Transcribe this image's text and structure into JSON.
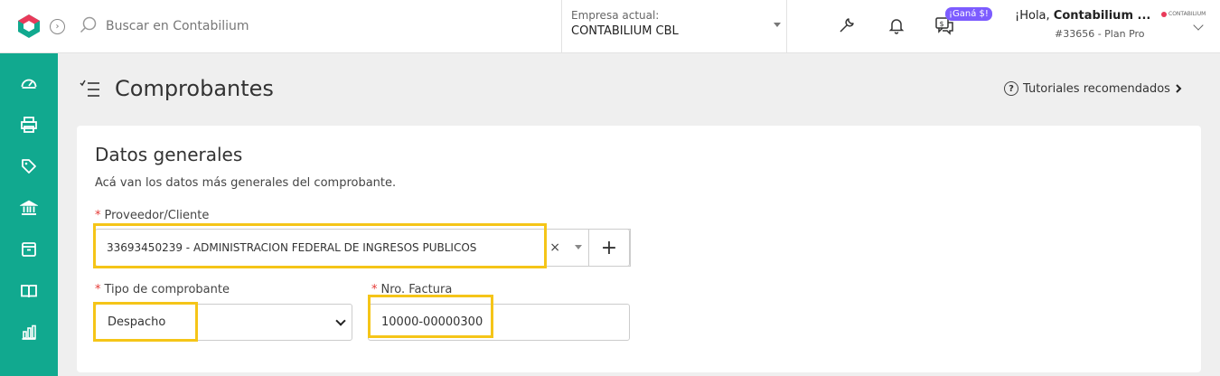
{
  "topbar": {
    "search_placeholder": "Buscar en Contabilium",
    "company_label": "Empresa actual:",
    "company_name": "CONTABILIUM CBL",
    "promo_badge": "¡Ganá $!",
    "greeting_prefix": "¡Hola, ",
    "greeting_name": "Contabilium ...",
    "account_id": "#33656 - Plan Pro",
    "mini_logo_text": "CONTABILIUM"
  },
  "sidebar": {
    "items": [
      {
        "icon": "dashboard-icon"
      },
      {
        "icon": "printer-icon"
      },
      {
        "icon": "tag-icon"
      },
      {
        "icon": "bank-icon"
      },
      {
        "icon": "inventory-box-icon"
      },
      {
        "icon": "book-icon"
      },
      {
        "icon": "reports-chart-icon"
      }
    ]
  },
  "page": {
    "title": "Comprobantes",
    "tutorials_label": "Tutoriales recomendados"
  },
  "card": {
    "title": "Datos generales",
    "description": "Acá van los datos más generales del comprobante.",
    "proveedor": {
      "label": "Proveedor/Cliente",
      "value": "33693450239 - ADMINISTRACION FEDERAL DE INGRESOS PUBLICOS",
      "clear": "×",
      "add": "+"
    },
    "tipo": {
      "label": "Tipo de comprobante",
      "value": "Despacho"
    },
    "nro": {
      "label": "Nro. Factura",
      "value": "10000-00000300"
    },
    "required_marker": "*"
  },
  "colors": {
    "sidebar": "#11a98f",
    "highlight": "#f5c518",
    "required": "#e53935",
    "badge": "#7c5cff"
  }
}
